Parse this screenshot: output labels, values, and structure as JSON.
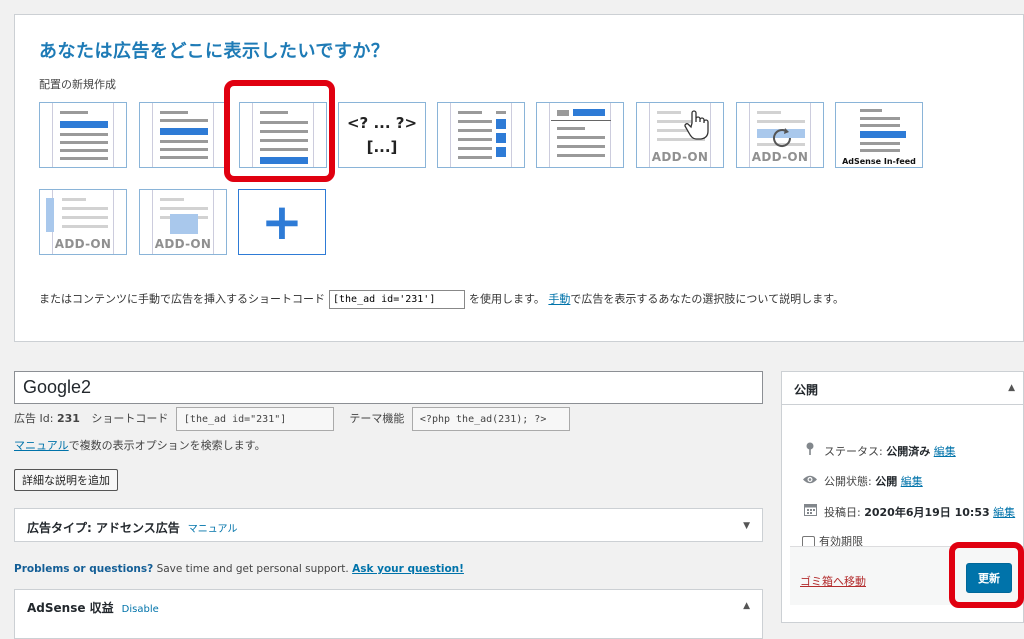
{
  "placement": {
    "title": "あなたは広告をどこに表示したいですか？",
    "subtitle": "配置の新規作成",
    "code_tile": {
      "line1": "<? ... ?>",
      "line2": "[...]"
    },
    "addon_label": "ADD-ON",
    "infeed_label": "AdSense In-feed",
    "plus_label": "+",
    "shortcode_prefix": "またはコンテンツに手動で広告を挿入するショートコード",
    "shortcode_value": "[the_ad id='231']",
    "shortcode_mid": "を使用します。",
    "manual_link": "手動",
    "shortcode_suffix": "で広告を表示するあなたの選択肢について説明します。"
  },
  "ad": {
    "title": "Google2",
    "id_label": "広告 Id:",
    "id_value": "231",
    "shortcode_label": "ショートコード",
    "shortcode_value": "[the_ad id=\"231\"]",
    "theme_label": "テーマ機能",
    "theme_value": "<?php the_ad(231); ?>",
    "manual_link": "マニュアル",
    "manual_text": "で複数の表示オプションを検索します。",
    "add_desc_button": "詳細な説明を追加"
  },
  "ad_type_box": {
    "title": "広告タイプ: アドセンス広告",
    "link": "マニュアル",
    "toggle": "▼"
  },
  "problems": {
    "strong": "Problems or questions?",
    "text": " Save time and get personal support. ",
    "link": "Ask your question!"
  },
  "adsense_box": {
    "title": "AdSense 収益",
    "link": "Disable",
    "toggle": "▲"
  },
  "publish": {
    "title": "公開",
    "toggle": "▲",
    "status_label": "ステータス:",
    "status_value": "公開済み",
    "visibility_label": "公開状態:",
    "visibility_value": "公開",
    "date_label": "投稿日:",
    "date_value": "2020年6月19日 10:53",
    "edit_link": "編集",
    "expiry_label": "有効期限",
    "trash_link": "ゴミ箱へ移動",
    "update_button": "更新"
  },
  "colors": {
    "accent": "#1e7bb6",
    "primary_button": "#0073aa",
    "highlight": "#e00010",
    "ad_block": "#2e7bd6"
  }
}
